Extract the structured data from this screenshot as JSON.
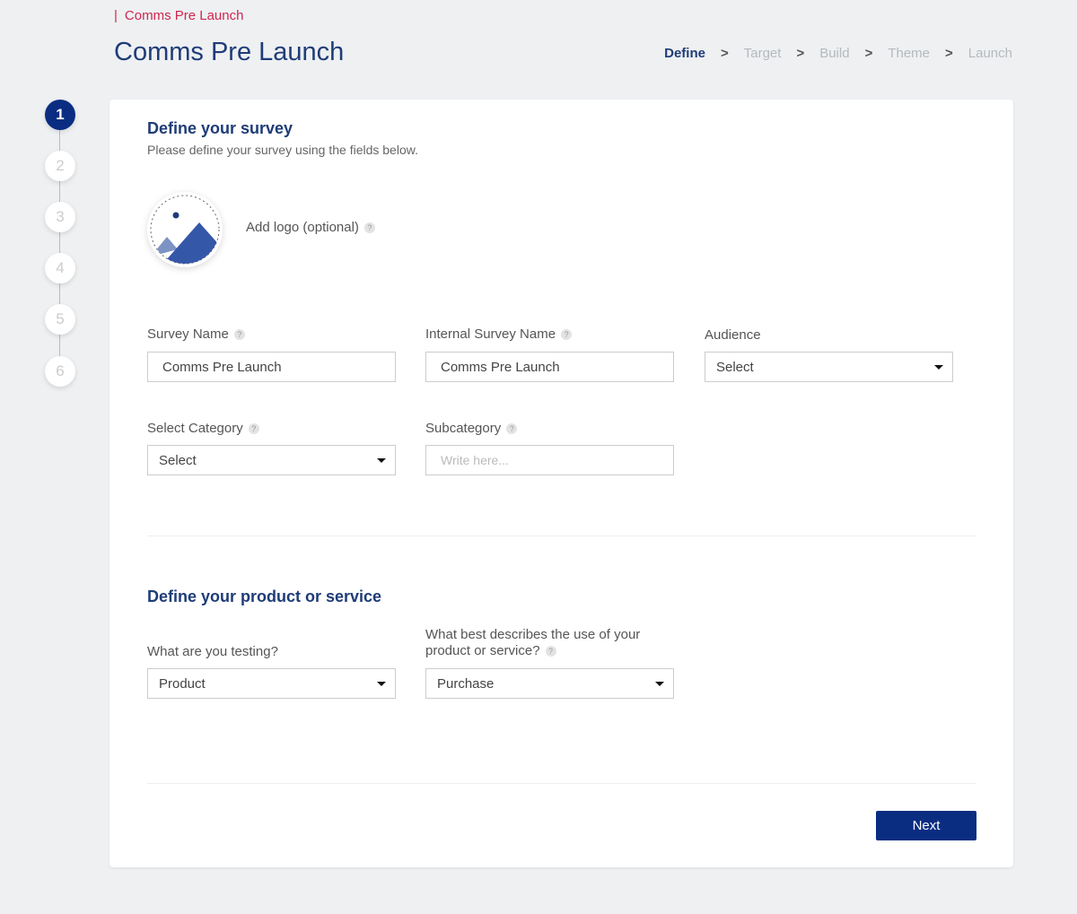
{
  "breadcrumb": "Comms Pre Launch",
  "title": "Comms Pre Launch",
  "nav": [
    "Define",
    "Target",
    "Build",
    "Theme",
    "Launch"
  ],
  "stepper": [
    "1",
    "2",
    "3",
    "4",
    "5",
    "6"
  ],
  "section1": {
    "title": "Define your survey",
    "subtitle": "Please define your survey using the fields below.",
    "logo_label": "Add logo (optional)",
    "survey_name_label": "Survey Name",
    "survey_name": "Comms Pre Launch",
    "internal_name_label": "Internal Survey Name",
    "internal_name": "Comms Pre Launch",
    "audience_label": "Audience",
    "audience": "Select",
    "category_label": "Select Category",
    "category": "Select",
    "subcategory_label": "Subcategory",
    "subcategory_placeholder": "Write here..."
  },
  "section2": {
    "title": "Define your product or service",
    "testing_label": "What are you testing?",
    "testing": "Product",
    "use_label_1": "What best describes the use of your",
    "use_label_2": "product or service?",
    "use": "Purchase"
  },
  "help": "?",
  "next": "Next"
}
